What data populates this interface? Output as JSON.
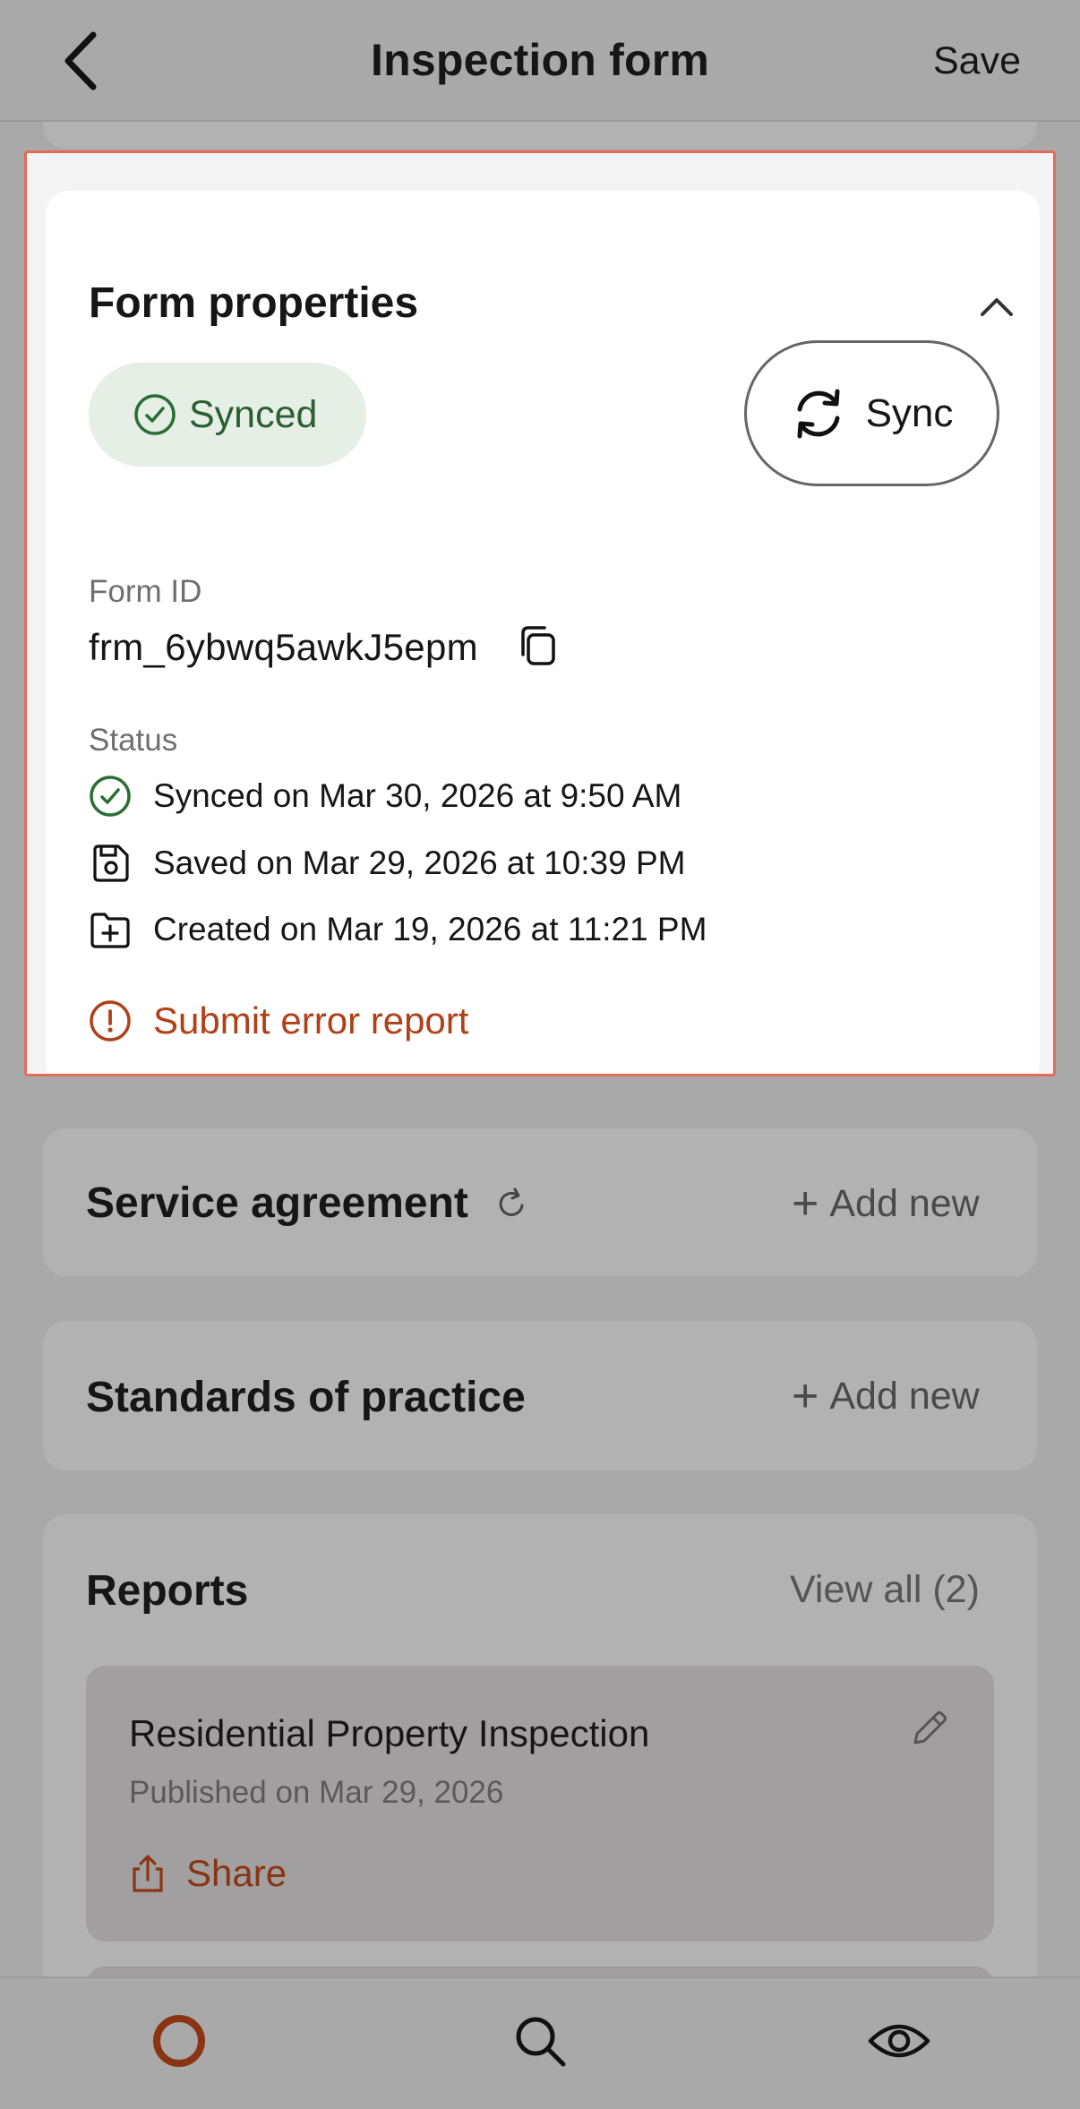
{
  "header": {
    "title": "Inspection form",
    "save_label": "Save"
  },
  "form_properties": {
    "title": "Form properties",
    "sync_state_label": "Synced",
    "sync_button_label": "Sync",
    "form_id_label": "Form ID",
    "form_id_value": "frm_6ybwq5awkJ5epm",
    "status_label": "Status",
    "status_rows": [
      {
        "icon": "check-circle-icon",
        "text": "Synced on Mar 30, 2026 at 9:50 AM"
      },
      {
        "icon": "save-disk-icon",
        "text": "Saved on Mar 29, 2026 at 10:39 PM"
      },
      {
        "icon": "folder-plus-icon",
        "text": "Created on Mar 19, 2026 at 11:21 PM"
      }
    ],
    "error_report_label": "Submit error report"
  },
  "service_agreement": {
    "title": "Service agreement",
    "add_label": "Add new"
  },
  "standards": {
    "title": "Standards of practice",
    "add_label": "Add new"
  },
  "reports": {
    "title": "Reports",
    "view_all_label": "View all (2)",
    "items": [
      {
        "title": "Residential Property Inspection",
        "date": "Published on Mar 29, 2026",
        "share_label": "Share"
      }
    ]
  },
  "colors": {
    "accent": "#b04017",
    "success": "#2b5e31",
    "success_bg": "#e5efe6",
    "highlight_border": "#e66a58"
  },
  "bottom_nav": {
    "icons": [
      "home-circle-icon",
      "search-icon",
      "eye-icon"
    ]
  }
}
